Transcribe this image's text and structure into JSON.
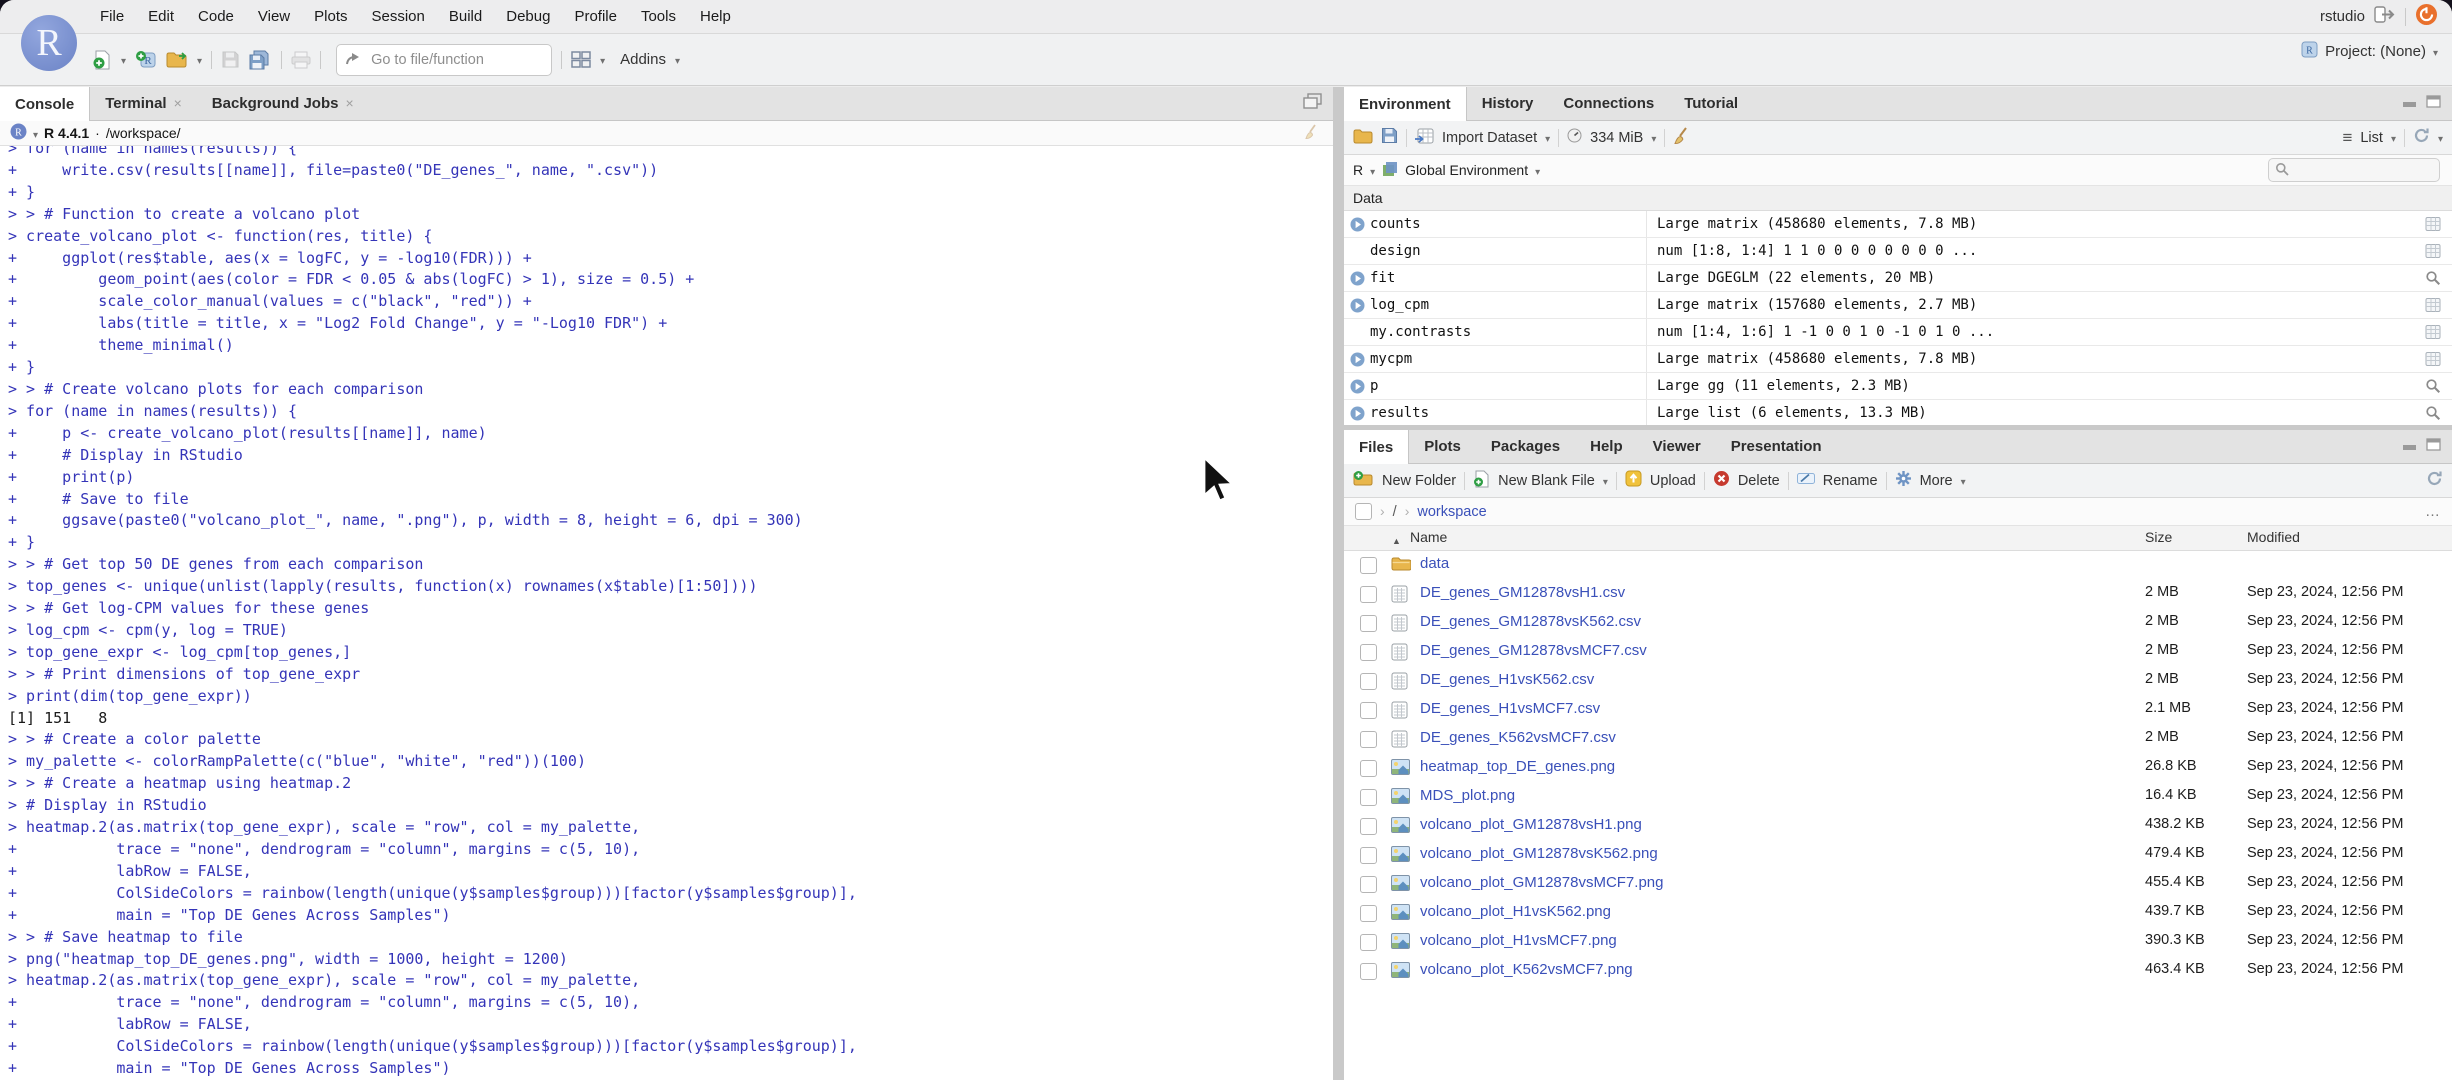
{
  "menu_bar": {
    "items": [
      "File",
      "Edit",
      "Code",
      "View",
      "Plots",
      "Session",
      "Build",
      "Debug",
      "Profile",
      "Tools",
      "Help"
    ],
    "account_label": "rstudio"
  },
  "toolbar": {
    "goto_placeholder": "Go to file/function",
    "addins_label": "Addins",
    "project_label": "Project: (None)"
  },
  "console": {
    "tabs": [
      "Console",
      "Terminal",
      "Background Jobs"
    ],
    "active_tab": "Console",
    "r_version": "R 4.4.1",
    "version_separator": "·",
    "working_dir": "/workspace/",
    "lines": [
      {
        "t": "> for (name in names(results)) {",
        "k": "input"
      },
      {
        "t": "+     write.csv(results[[name]], file=paste0(\"DE_genes_\", name, \".csv\"))",
        "k": "input"
      },
      {
        "t": "+ }",
        "k": "input"
      },
      {
        "t": "> > # Function to create a volcano plot",
        "k": "input"
      },
      {
        "t": "> create_volcano_plot <- function(res, title) {",
        "k": "input"
      },
      {
        "t": "+     ggplot(res$table, aes(x = logFC, y = -log10(FDR))) +",
        "k": "input"
      },
      {
        "t": "+         geom_point(aes(color = FDR < 0.05 & abs(logFC) > 1), size = 0.5) +",
        "k": "input"
      },
      {
        "t": "+         scale_color_manual(values = c(\"black\", \"red\")) +",
        "k": "input"
      },
      {
        "t": "+         labs(title = title, x = \"Log2 Fold Change\", y = \"-Log10 FDR\") +",
        "k": "input"
      },
      {
        "t": "+         theme_minimal()",
        "k": "input"
      },
      {
        "t": "+ }",
        "k": "input"
      },
      {
        "t": "> > # Create volcano plots for each comparison",
        "k": "input"
      },
      {
        "t": "> for (name in names(results)) {",
        "k": "input"
      },
      {
        "t": "+     p <- create_volcano_plot(results[[name]], name)",
        "k": "input"
      },
      {
        "t": "+     # Display in RStudio",
        "k": "input"
      },
      {
        "t": "+     print(p)",
        "k": "input"
      },
      {
        "t": "+     # Save to file",
        "k": "input"
      },
      {
        "t": "+     ggsave(paste0(\"volcano_plot_\", name, \".png\"), p, width = 8, height = 6, dpi = 300)",
        "k": "input"
      },
      {
        "t": "+ }",
        "k": "input"
      },
      {
        "t": "> > # Get top 50 DE genes from each comparison",
        "k": "input"
      },
      {
        "t": "> top_genes <- unique(unlist(lapply(results, function(x) rownames(x$table)[1:50])))",
        "k": "input"
      },
      {
        "t": "> > # Get log-CPM values for these genes",
        "k": "input"
      },
      {
        "t": "> log_cpm <- cpm(y, log = TRUE)",
        "k": "input"
      },
      {
        "t": "> top_gene_expr <- log_cpm[top_genes,]",
        "k": "input"
      },
      {
        "t": "> > # Print dimensions of top_gene_expr",
        "k": "input"
      },
      {
        "t": "> print(dim(top_gene_expr))",
        "k": "input"
      },
      {
        "t": "[1] 151   8",
        "k": "output"
      },
      {
        "t": "> > # Create a color palette",
        "k": "input"
      },
      {
        "t": "> my_palette <- colorRampPalette(c(\"blue\", \"white\", \"red\"))(100)",
        "k": "input"
      },
      {
        "t": "> > # Create a heatmap using heatmap.2",
        "k": "input"
      },
      {
        "t": "> # Display in RStudio",
        "k": "input"
      },
      {
        "t": "> heatmap.2(as.matrix(top_gene_expr), scale = \"row\", col = my_palette,",
        "k": "input"
      },
      {
        "t": "+           trace = \"none\", dendrogram = \"column\", margins = c(5, 10),",
        "k": "input"
      },
      {
        "t": "+           labRow = FALSE,",
        "k": "input"
      },
      {
        "t": "+           ColSideColors = rainbow(length(unique(y$samples$group)))[factor(y$samples$group)],",
        "k": "input"
      },
      {
        "t": "+           main = \"Top DE Genes Across Samples\")",
        "k": "input"
      },
      {
        "t": "> > # Save heatmap to file",
        "k": "input"
      },
      {
        "t": "> png(\"heatmap_top_DE_genes.png\", width = 1000, height = 1200)",
        "k": "input"
      },
      {
        "t": "> heatmap.2(as.matrix(top_gene_expr), scale = \"row\", col = my_palette,",
        "k": "input"
      },
      {
        "t": "+           trace = \"none\", dendrogram = \"column\", margins = c(5, 10),",
        "k": "input"
      },
      {
        "t": "+           labRow = FALSE,",
        "k": "input"
      },
      {
        "t": "+           ColSideColors = rainbow(length(unique(y$samples$group)))[factor(y$samples$group)],",
        "k": "input"
      },
      {
        "t": "+           main = \"Top DE Genes Across Samples\")",
        "k": "input"
      }
    ]
  },
  "environment": {
    "tabs": [
      "Environment",
      "History",
      "Connections",
      "Tutorial"
    ],
    "active_tab": "Environment",
    "toolbar": {
      "import_label": "Import Dataset",
      "memory_label": "334 MiB",
      "view_label": "List"
    },
    "scope": {
      "lang_label": "R",
      "env_label": "Global Environment"
    },
    "section_label": "Data",
    "search_value": "",
    "objects": [
      {
        "name": "counts",
        "value": "Large matrix (458680 elements,  7.8 MB)",
        "expandable": true,
        "action": "table"
      },
      {
        "name": "design",
        "value": "num [1:8, 1:4] 1 1 0 0 0 0 0 0 0 0 ...",
        "expandable": false,
        "action": "table"
      },
      {
        "name": "fit",
        "value": "Large DGEGLM (22 elements,  20 MB)",
        "expandable": true,
        "action": "search"
      },
      {
        "name": "log_cpm",
        "value": "Large matrix (157680 elements,  2.7 MB)",
        "expandable": true,
        "action": "table"
      },
      {
        "name": "my.contrasts",
        "value": "num [1:4, 1:6] 1 -1 0 0 1 0 -1 0 1 0 ...",
        "expandable": false,
        "action": "table"
      },
      {
        "name": "mycpm",
        "value": "Large matrix (458680 elements,  7.8 MB)",
        "expandable": true,
        "action": "table"
      },
      {
        "name": "p",
        "value": "Large gg (11 elements,  2.3 MB)",
        "expandable": true,
        "action": "search"
      },
      {
        "name": "results",
        "value": "Large list (6 elements,  13.3 MB)",
        "expandable": true,
        "action": "search"
      }
    ]
  },
  "files": {
    "tabs": [
      "Files",
      "Plots",
      "Packages",
      "Help",
      "Viewer",
      "Presentation"
    ],
    "active_tab": "Files",
    "toolbar": {
      "new_folder": "New Folder",
      "new_blank_file": "New Blank File",
      "upload": "Upload",
      "delete": "Delete",
      "rename": "Rename",
      "more": "More"
    },
    "path": {
      "root": "/",
      "dir": "workspace"
    },
    "columns": [
      "Name",
      "Size",
      "Modified"
    ],
    "rows": [
      {
        "name": "data",
        "type": "folder",
        "size": "",
        "modified": ""
      },
      {
        "name": "DE_genes_GM12878vsH1.csv",
        "type": "table",
        "size": "2 MB",
        "modified": "Sep 23, 2024, 12:56 PM"
      },
      {
        "name": "DE_genes_GM12878vsK562.csv",
        "type": "table",
        "size": "2 MB",
        "modified": "Sep 23, 2024, 12:56 PM"
      },
      {
        "name": "DE_genes_GM12878vsMCF7.csv",
        "type": "table",
        "size": "2 MB",
        "modified": "Sep 23, 2024, 12:56 PM"
      },
      {
        "name": "DE_genes_H1vsK562.csv",
        "type": "table",
        "size": "2 MB",
        "modified": "Sep 23, 2024, 12:56 PM"
      },
      {
        "name": "DE_genes_H1vsMCF7.csv",
        "type": "table",
        "size": "2.1 MB",
        "modified": "Sep 23, 2024, 12:56 PM"
      },
      {
        "name": "DE_genes_K562vsMCF7.csv",
        "type": "table",
        "size": "2 MB",
        "modified": "Sep 23, 2024, 12:56 PM"
      },
      {
        "name": "heatmap_top_DE_genes.png",
        "type": "image",
        "size": "26.8 KB",
        "modified": "Sep 23, 2024, 12:56 PM"
      },
      {
        "name": "MDS_plot.png",
        "type": "image",
        "size": "16.4 KB",
        "modified": "Sep 23, 2024, 12:56 PM"
      },
      {
        "name": "volcano_plot_GM12878vsH1.png",
        "type": "image",
        "size": "438.2 KB",
        "modified": "Sep 23, 2024, 12:56 PM"
      },
      {
        "name": "volcano_plot_GM12878vsK562.png",
        "type": "image",
        "size": "479.4 KB",
        "modified": "Sep 23, 2024, 12:56 PM"
      },
      {
        "name": "volcano_plot_GM12878vsMCF7.png",
        "type": "image",
        "size": "455.4 KB",
        "modified": "Sep 23, 2024, 12:56 PM"
      },
      {
        "name": "volcano_plot_H1vsK562.png",
        "type": "image",
        "size": "439.7 KB",
        "modified": "Sep 23, 2024, 12:56 PM"
      },
      {
        "name": "volcano_plot_H1vsMCF7.png",
        "type": "image",
        "size": "390.3 KB",
        "modified": "Sep 23, 2024, 12:56 PM"
      },
      {
        "name": "volcano_plot_K562vsMCF7.png",
        "type": "image",
        "size": "463.4 KB",
        "modified": "Sep 23, 2024, 12:56 PM"
      }
    ]
  },
  "colors": {
    "console_text": "#3434b8",
    "file_link": "#3a50b9",
    "active_tab_bg": "#ffffff",
    "chrome_bg": "#f0f1f2",
    "backdrop": "#14111c"
  }
}
